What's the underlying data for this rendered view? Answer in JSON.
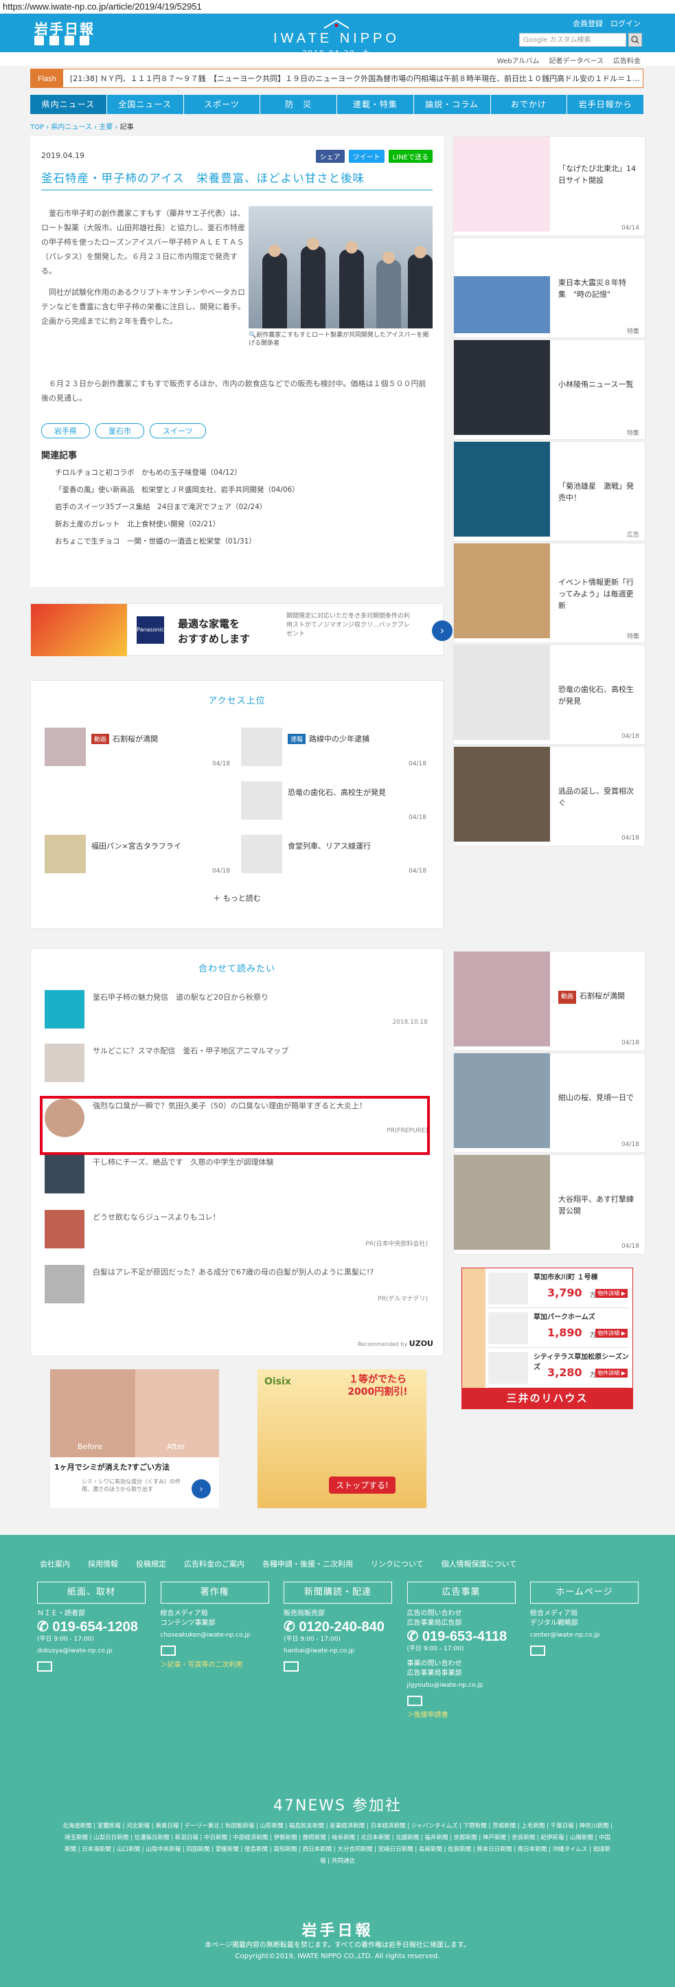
{
  "url": "https://www.iwate-np.co.jp/article/2019/4/19/52951",
  "header": {
    "logo": "岩手日報",
    "site_name": "IWATE NIPPO",
    "date": "2019.04.20. 土",
    "member_register": "会員登録",
    "login": "ログイン",
    "search_placeholder": "Google カスタム検索"
  },
  "subheader": [
    "Webアルバム",
    "記者データベース",
    "広告料金"
  ],
  "flash": {
    "label": "Flash",
    "text": "[21:38] ＮＹ円、１１１円８７～９７銭　【ニューヨーク共同】１９日のニューヨーク外国為替市場の円相場は午前８時半現在、前日比１０銭円高ドル安の１ドル＝１…"
  },
  "nav": [
    "県内ニュース",
    "全国ニュース",
    "スポーツ",
    "防　災",
    "連載・特集",
    "論説・コラム",
    "おでかけ",
    "岩手日報から"
  ],
  "breadcrumb": [
    "TOP",
    "県内ニュース",
    "主要",
    "記事"
  ],
  "article": {
    "date": "2019.04.19",
    "share": [
      "シェア",
      "ツイート",
      "LINEで送る"
    ],
    "title": "釜石特産・甲子柿のアイス　栄養豊富、ほどよい甘さと後味",
    "p1": "釜石市甲子町の創作農家こすもす（藤井サエ子代表）は、ロート製薬（大阪市、山田邦雄社長）と協力し、釜石市特産の甲子柿を使ったローズンアイスバー甲子柿ＰＡＬＥＴＡＳ（パレタス）を開発した。６月２３日に市内限定で発売する。",
    "p2": "同社が試験化作用のあるクリプトキサンチンやベータカロテンなどを豊富に含む甲子柿の栄養に注目し、開発に着手。企画から完成までに約２年を費やした。",
    "p3": "６月２３日から創作農家こすもすで販売するほか、市内の飲食店などでの販売も検討中。価格は１個５００円前後の見通し。",
    "photo_caption": "創作農家こすもすとロート製薬が共同開発したアイスバーを掲げる関係者",
    "tags": [
      "岩手県",
      "釜石市",
      "スイーツ"
    ],
    "related_heading": "関連記事",
    "related": [
      "チロルチョコと初コラボ　かもめの玉子味登場（04/12）",
      "「釜香の風」使い新商品　松栄堂とＪＲ盛岡支社、岩手共同開発（04/06）",
      "岩手のスイーツ35ブース集結　24日まで滝沢でフェア（02/24）",
      "新お土産のガレット　北上食材使い開発（02/21）",
      "おちょこで生チョコ　一関・世嬉の一酒造と松栄堂（01/31）"
    ]
  },
  "ad_banner": {
    "logo": "Panasonic",
    "headline": "最適な家電を\nおすすめします",
    "sub": "期間限定に対応いただ冬き多対期間条件の利用ストがてノジマオンジ収クリ...バックプレゼント"
  },
  "access": {
    "heading": "アクセス上位",
    "items": [
      {
        "badge": "動画",
        "badge_color": "#c0392b",
        "title": "石割桜が満開",
        "date": "04/18"
      },
      {
        "badge": "速報",
        "badge_color": "#1b6fb4",
        "title": "路線中の少年逮捕",
        "date": "04/18"
      },
      {
        "badge": "",
        "title": "恐竜の歯化石、高校生が発見",
        "date": "04/18"
      },
      {
        "badge": "",
        "title": "福田パン×宮古タラフライ",
        "date": "04/18"
      },
      {
        "badge": "",
        "title": "食堂列車、リアス線運行",
        "date": "04/18"
      }
    ],
    "more": "もっと読む"
  },
  "recommend": {
    "heading": "合わせて読みたい",
    "items": [
      {
        "title": "釜石甲子柿の魅力発信　道の駅など20日から秋祭り",
        "source": "2018.10.18"
      },
      {
        "title": "サルどこに？スマホ配信　釜石・甲子地区アニマルマップ",
        "source": ""
      },
      {
        "title": "強烈な口臭が一瞬で？気田久美子（50）の口臭ない理由が簡単すぎると大炎上！",
        "source": "PR(FREPURE)"
      },
      {
        "title": "干し柿にチーズ、絶品です　久慈の中学生が調理体験",
        "source": ""
      },
      {
        "title": "どうせ飲むならジュースよりもコレ！",
        "source": "PR(日本中央飲料会社)"
      },
      {
        "title": "白髪はアレ不足が原因だった？ある成分で67歳の母の白髪が別人のように黒髪に!?",
        "source": "PR(ゲルマナデリ)"
      }
    ],
    "credit": "Recommended by",
    "credit_brand": "UZOU"
  },
  "sidebar": [
    {
      "title": "「なげたび北東北」14日サイト開設",
      "date": "04/14"
    },
    {
      "title": "東日本大震災８年特集　\"時の記憶\"",
      "date": "特集"
    },
    {
      "title": "小林陵侑ニュース一覧",
      "date": "特集"
    },
    {
      "title": "「菊池雄星　激戦」発売中！",
      "date": "広告"
    },
    {
      "title": "イベント情報更新「行ってみよう」は毎週更新",
      "date": "特集"
    },
    {
      "title": "恐竜の歯化石、高校生が発見",
      "date": "04/18"
    },
    {
      "title": "逃品の証し、受賞相次ぐ",
      "date": "04/18"
    },
    {
      "badge": "動画",
      "title": "石割桜が満開",
      "date": "04/18"
    },
    {
      "title": "紺山の桜、見頃一日で",
      "date": "04/18"
    },
    {
      "title": "大谷翔平、あす打撃練習公開",
      "date": "04/18"
    }
  ],
  "realestate_ad": {
    "rows": [
      {
        "name": "草加市氷川町 １号棟",
        "price": "3,790",
        "btn": "物件詳細 ▶"
      },
      {
        "name": "草加パークホームズ",
        "price": "1,890",
        "btn": "物件詳細 ▶"
      },
      {
        "name": "シティテラス草加松原シーズンズ",
        "price": "3,280",
        "btn": "物件詳細 ▶"
      }
    ],
    "unit": "万円",
    "brand": "三井のリハウス"
  },
  "bottom_ads": {
    "left": {
      "before": "Before",
      "after": "After",
      "caption": "1ヶ月でシミが消えた?すごい方法",
      "sub": "シミ・シワに有効な成分（くすみ）の作用、濃さのほうから取り出す"
    },
    "right": {
      "brand": "Oisix",
      "headline": "１等がでたら\n2000円割引!",
      "button": "ストップする!"
    }
  },
  "footer": {
    "links": [
      "会社案内",
      "採用情報",
      "投稿規定",
      "広告料金のご案内",
      "各種申請・後援・二次利用",
      "リンクについて",
      "個人情報保護について"
    ],
    "columns": [
      {
        "heading": "紙面、取材",
        "dept": "ＮＩＥ・読者部",
        "tel": "019-654-1208",
        "hours": "(平日 9:00 - 17:00)",
        "email": "dokusya@iwate-np.co.jp",
        "link": ""
      },
      {
        "heading": "著作権",
        "dept": "総合メディア局\nコンテンツ事業部",
        "tel": "",
        "hours": "",
        "email": "choseakuken@iwate-np.co.jp",
        "link": "＞記事・写真等の二次利用"
      },
      {
        "heading": "新聞購読・配達",
        "dept": "販売局販売部",
        "tel": "0120-240-840",
        "hours": "(平日 9:00 - 17:00)",
        "email": "hanbai@iwate-np.co.jp",
        "link": ""
      },
      {
        "heading": "広告事業",
        "dept": "広告の問い合わせ\n広告事業局広告部",
        "tel": "019-653-4118",
        "hours": "(平日 9:00 - 17:00)",
        "email": "jigyoubu@iwate-np.co.jp",
        "dept2": "事業の問い合わせ\n広告事業局事業部",
        "link": "＞後援申請書"
      },
      {
        "heading": "ホームページ",
        "dept": "総合メディア局\nデジタル戦略部",
        "tel": "",
        "hours": "",
        "email": "center@iwate-np.co.jp",
        "link": ""
      }
    ],
    "n47_title": "47NEWS 参加社",
    "n47_list": "北海道新聞 | 室蘭民報 | 河北新報 | 東奥日報 | デーリー東北 | 秋田魁新報 | 山形新聞 | 福島民友新聞 | 産業経済新聞 | 日本経済新聞 | ジャパンタイムズ | 下野新聞 | 茨城新聞 | 上毛新聞 | 千葉日報 | 神奈川新聞 | 埼玉新聞 | 山梨日日新聞 | 信濃毎日新聞 | 新潟日報 | 中日新聞 | 中部経済新聞 | 伊勢新聞 | 静岡新聞 | 岐阜新聞 | 北日本新聞 | 北國新聞 | 福井新聞 | 京都新聞 | 神戸新聞 | 奈良新聞 | 紀伊民報 | 山陽新聞 | 中国新聞 | 日本海新聞 | 山口新聞 | 山陰中央新報 | 四国新聞 | 愛媛新聞 | 徳島新聞 | 高知新聞 | 西日本新聞 | 大分合同新聞 | 宮崎日日新聞 | 長崎新聞 | 佐賀新聞 | 熊本日日新聞 | 南日本新聞 | 沖縄タイムス | 琉球新報 | 共同通信",
    "logo": "岩手日報",
    "notice": "本ページ掲載内容の無断転載を禁じます。すべての著作権は岩手日報社に帰属します。",
    "copyright": "Copyright©2019, IWATE NIPPO CO.,LTD. All rights reserved."
  }
}
